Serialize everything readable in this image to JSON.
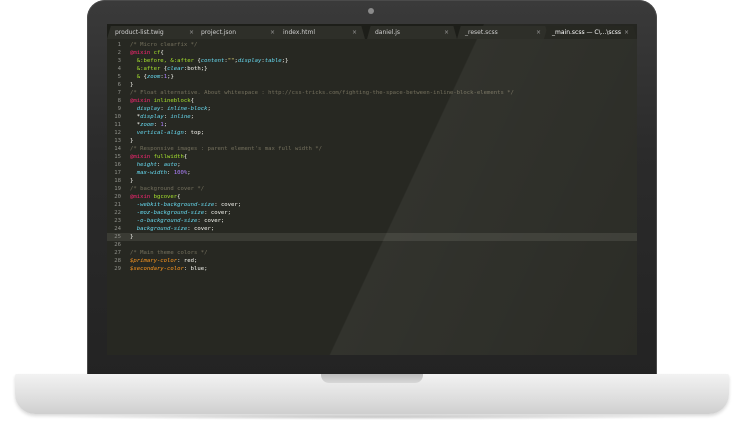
{
  "editor": {
    "tabs": [
      {
        "label": "product-list.twig",
        "close": "×"
      },
      {
        "label": "project.json",
        "close": "×"
      },
      {
        "label": "index.html",
        "close": "×"
      },
      {
        "label": "daniel.js",
        "close": "×"
      },
      {
        "label": "_reset.scss",
        "close": "×"
      },
      {
        "label": "_main.scss — C\\...\\scss",
        "close": "×"
      }
    ],
    "active_tab": 5,
    "current_line": 25,
    "colors": {
      "background": "#272822",
      "comment": "#75715e",
      "keyword": "#f92672",
      "name": "#a6e22e",
      "property": "#66d9ef",
      "string": "#e6db74",
      "number": "#ae81ff",
      "variable": "#fd971f"
    },
    "lines": [
      {
        "n": "1",
        "tokens": [
          {
            "t": "/* Micro clearfix */",
            "c": "comment"
          }
        ]
      },
      {
        "n": "2",
        "tokens": [
          {
            "t": "@mixin",
            "c": "at"
          },
          {
            "t": " cf",
            "c": "name"
          },
          {
            "t": "{",
            "c": "punct"
          }
        ]
      },
      {
        "n": "3",
        "tokens": [
          {
            "t": "  &:before, &:after ",
            "c": "sel"
          },
          {
            "t": "{",
            "c": "punct"
          },
          {
            "t": "content",
            "c": "prop"
          },
          {
            "t": ":",
            "c": "punct"
          },
          {
            "t": "\"\"",
            "c": "str"
          },
          {
            "t": ";",
            "c": "punct"
          },
          {
            "t": "display",
            "c": "prop"
          },
          {
            "t": ":",
            "c": "punct"
          },
          {
            "t": "table",
            "c": "prop"
          },
          {
            "t": ";}",
            "c": "punct"
          }
        ]
      },
      {
        "n": "4",
        "tokens": [
          {
            "t": "  &:after ",
            "c": "sel"
          },
          {
            "t": "{",
            "c": "punct"
          },
          {
            "t": "clear",
            "c": "prop"
          },
          {
            "t": ":both;}",
            "c": "punct"
          }
        ]
      },
      {
        "n": "5",
        "tokens": [
          {
            "t": "  & ",
            "c": "sel"
          },
          {
            "t": "{",
            "c": "punct"
          },
          {
            "t": "zoom",
            "c": "prop"
          },
          {
            "t": ":",
            "c": "punct"
          },
          {
            "t": "1",
            "c": "num"
          },
          {
            "t": ";}",
            "c": "punct"
          }
        ]
      },
      {
        "n": "6",
        "tokens": [
          {
            "t": "}",
            "c": "punct"
          }
        ]
      },
      {
        "n": "7",
        "tokens": [
          {
            "t": "/* Float alternative. About whitespace : http://css-tricks.com/fighting-the-space-between-inline-block-elements */",
            "c": "comment"
          }
        ]
      },
      {
        "n": "8",
        "tokens": [
          {
            "t": "@mixin",
            "c": "at"
          },
          {
            "t": " inlineblock",
            "c": "name"
          },
          {
            "t": "{",
            "c": "punct"
          }
        ]
      },
      {
        "n": "9",
        "tokens": [
          {
            "t": "  display",
            "c": "prop"
          },
          {
            "t": ": ",
            "c": "punct"
          },
          {
            "t": "inline-block",
            "c": "prop"
          },
          {
            "t": ";",
            "c": "punct"
          }
        ]
      },
      {
        "n": "10",
        "tokens": [
          {
            "t": "  *",
            "c": "punct"
          },
          {
            "t": "display",
            "c": "prop"
          },
          {
            "t": ": ",
            "c": "punct"
          },
          {
            "t": "inline",
            "c": "prop"
          },
          {
            "t": ";",
            "c": "punct"
          }
        ]
      },
      {
        "n": "11",
        "tokens": [
          {
            "t": "  *",
            "c": "punct"
          },
          {
            "t": "zoom",
            "c": "prop"
          },
          {
            "t": ": ",
            "c": "punct"
          },
          {
            "t": "1",
            "c": "num"
          },
          {
            "t": ";",
            "c": "punct"
          }
        ]
      },
      {
        "n": "12",
        "tokens": [
          {
            "t": "  vertical-align",
            "c": "prop"
          },
          {
            "t": ": top;",
            "c": "punct"
          }
        ]
      },
      {
        "n": "13",
        "tokens": [
          {
            "t": "}",
            "c": "punct"
          }
        ]
      },
      {
        "n": "14",
        "tokens": [
          {
            "t": "/* Responsive images : parent element's max full width */",
            "c": "comment"
          }
        ]
      },
      {
        "n": "15",
        "tokens": [
          {
            "t": "@mixin",
            "c": "at"
          },
          {
            "t": " fullwidth",
            "c": "name"
          },
          {
            "t": "{",
            "c": "punct"
          }
        ]
      },
      {
        "n": "16",
        "tokens": [
          {
            "t": "  height",
            "c": "prop"
          },
          {
            "t": ": ",
            "c": "punct"
          },
          {
            "t": "auto",
            "c": "prop"
          },
          {
            "t": ";",
            "c": "punct"
          }
        ]
      },
      {
        "n": "17",
        "tokens": [
          {
            "t": "  max-width",
            "c": "prop"
          },
          {
            "t": ": ",
            "c": "punct"
          },
          {
            "t": "100%",
            "c": "num"
          },
          {
            "t": ";",
            "c": "punct"
          }
        ]
      },
      {
        "n": "18",
        "tokens": [
          {
            "t": "}",
            "c": "punct"
          }
        ]
      },
      {
        "n": "19",
        "tokens": [
          {
            "t": "/* background cover */",
            "c": "comment"
          }
        ]
      },
      {
        "n": "20",
        "tokens": [
          {
            "t": "@mixin",
            "c": "at"
          },
          {
            "t": " bgcover",
            "c": "name"
          },
          {
            "t": "{",
            "c": "punct"
          }
        ]
      },
      {
        "n": "21",
        "tokens": [
          {
            "t": "  -webkit-background-size",
            "c": "prop"
          },
          {
            "t": ": cover;",
            "c": "punct"
          }
        ]
      },
      {
        "n": "22",
        "tokens": [
          {
            "t": "  -moz-background-size",
            "c": "prop"
          },
          {
            "t": ": cover;",
            "c": "punct"
          }
        ]
      },
      {
        "n": "23",
        "tokens": [
          {
            "t": "  -o-background-size",
            "c": "prop"
          },
          {
            "t": ": cover;",
            "c": "punct"
          }
        ]
      },
      {
        "n": "24",
        "tokens": [
          {
            "t": "  background-size",
            "c": "prop"
          },
          {
            "t": ": cover;",
            "c": "punct"
          }
        ]
      },
      {
        "n": "25",
        "tokens": [
          {
            "t": "}",
            "c": "punct"
          }
        ]
      },
      {
        "n": "26",
        "tokens": []
      },
      {
        "n": "27",
        "tokens": [
          {
            "t": "/* Main theme colors */",
            "c": "comment"
          }
        ]
      },
      {
        "n": "28",
        "tokens": [
          {
            "t": "$primary-color",
            "c": "var"
          },
          {
            "t": ": red;",
            "c": "punct"
          }
        ]
      },
      {
        "n": "29",
        "tokens": [
          {
            "t": "$secondary-color",
            "c": "var"
          },
          {
            "t": ": blue;",
            "c": "punct"
          }
        ]
      }
    ]
  }
}
